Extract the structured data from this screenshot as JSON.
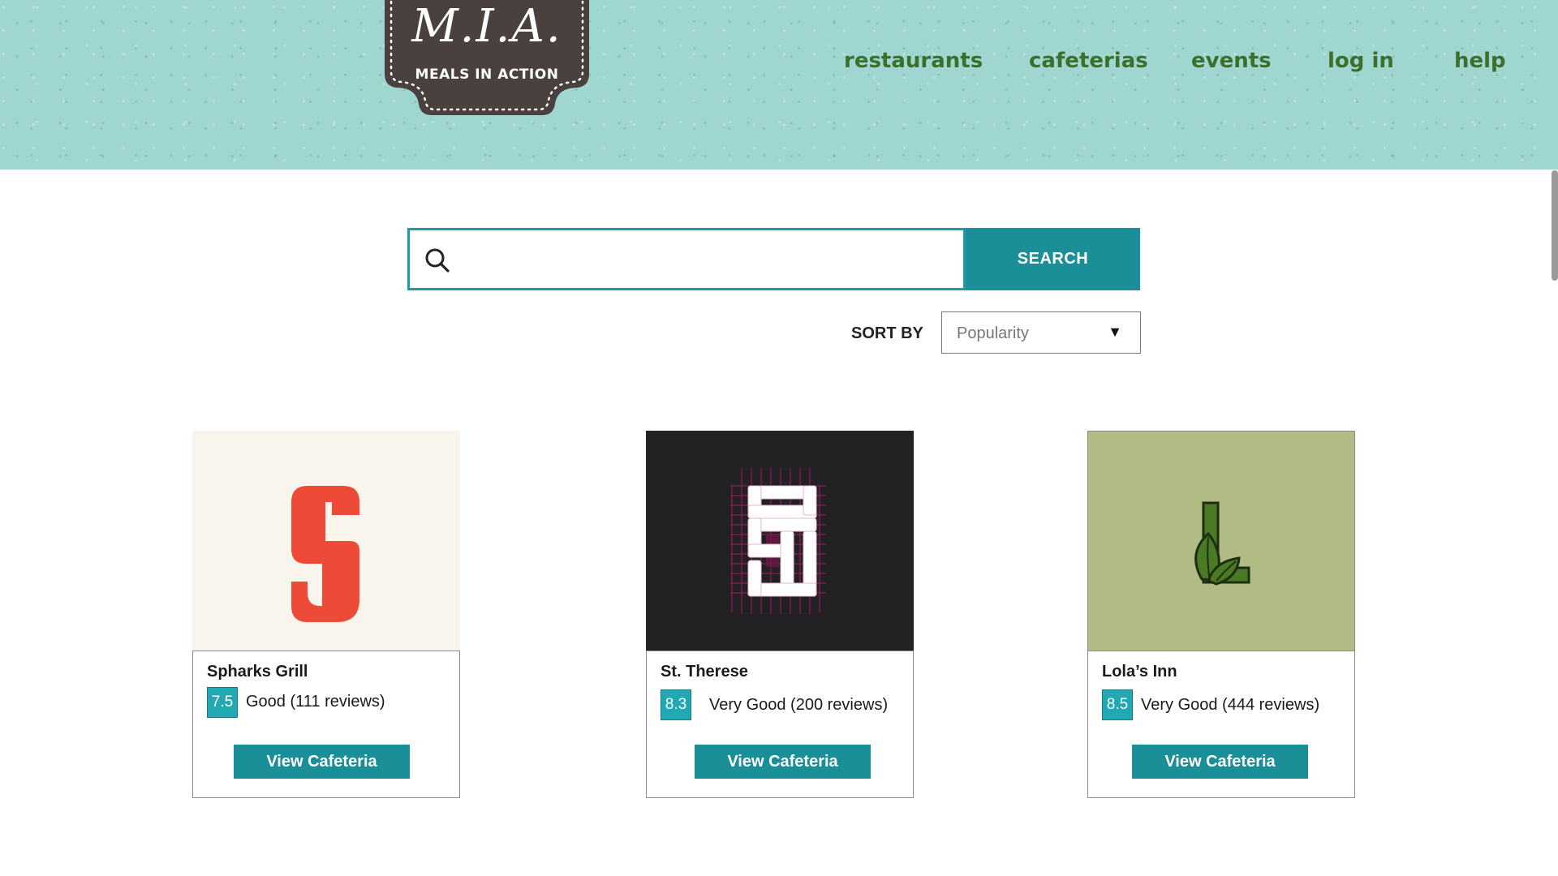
{
  "logo": {
    "title": "M.I.A.",
    "subtitle": "MEALS IN ACTION"
  },
  "nav": {
    "items": [
      {
        "label": "restaurants"
      },
      {
        "label": "cafeterias"
      },
      {
        "label": "events"
      },
      {
        "label": "log in"
      },
      {
        "label": "help"
      }
    ]
  },
  "search": {
    "placeholder": "",
    "value": "",
    "button_label": "SEARCH",
    "icon": "search-icon"
  },
  "sort": {
    "label": "SORT BY",
    "selected": "Popularity",
    "arrow": "▼"
  },
  "cards": [
    {
      "name": "Spharks Grill",
      "rating": "7.5",
      "rating_text": "Good (111 reviews)",
      "button_label": "View Cafeteria",
      "logo_icon": "spharks-s-logo",
      "image_bg": "#f9f4ec",
      "accent": "#ee4a38"
    },
    {
      "name": "St. Therese",
      "rating": "8.3",
      "rating_text": "Very Good (200 reviews)",
      "button_label": "View Cafeteria",
      "logo_icon": "st-therese-grid-logo",
      "image_bg": "#222225",
      "accent": "#b8156e"
    },
    {
      "name": "Lola’s Inn",
      "rating": "8.5",
      "rating_text": "Very Good (444 reviews)",
      "button_label": "View Cafeteria",
      "logo_icon": "lolas-inn-leaf-logo",
      "image_bg": "#b1bb84",
      "accent": "#4a7a23"
    }
  ],
  "colors": {
    "header_bg": "#9fd6d0",
    "nav_text": "#3b6f2c",
    "primary": "#1a8f97",
    "badge": "#20a8b3"
  }
}
